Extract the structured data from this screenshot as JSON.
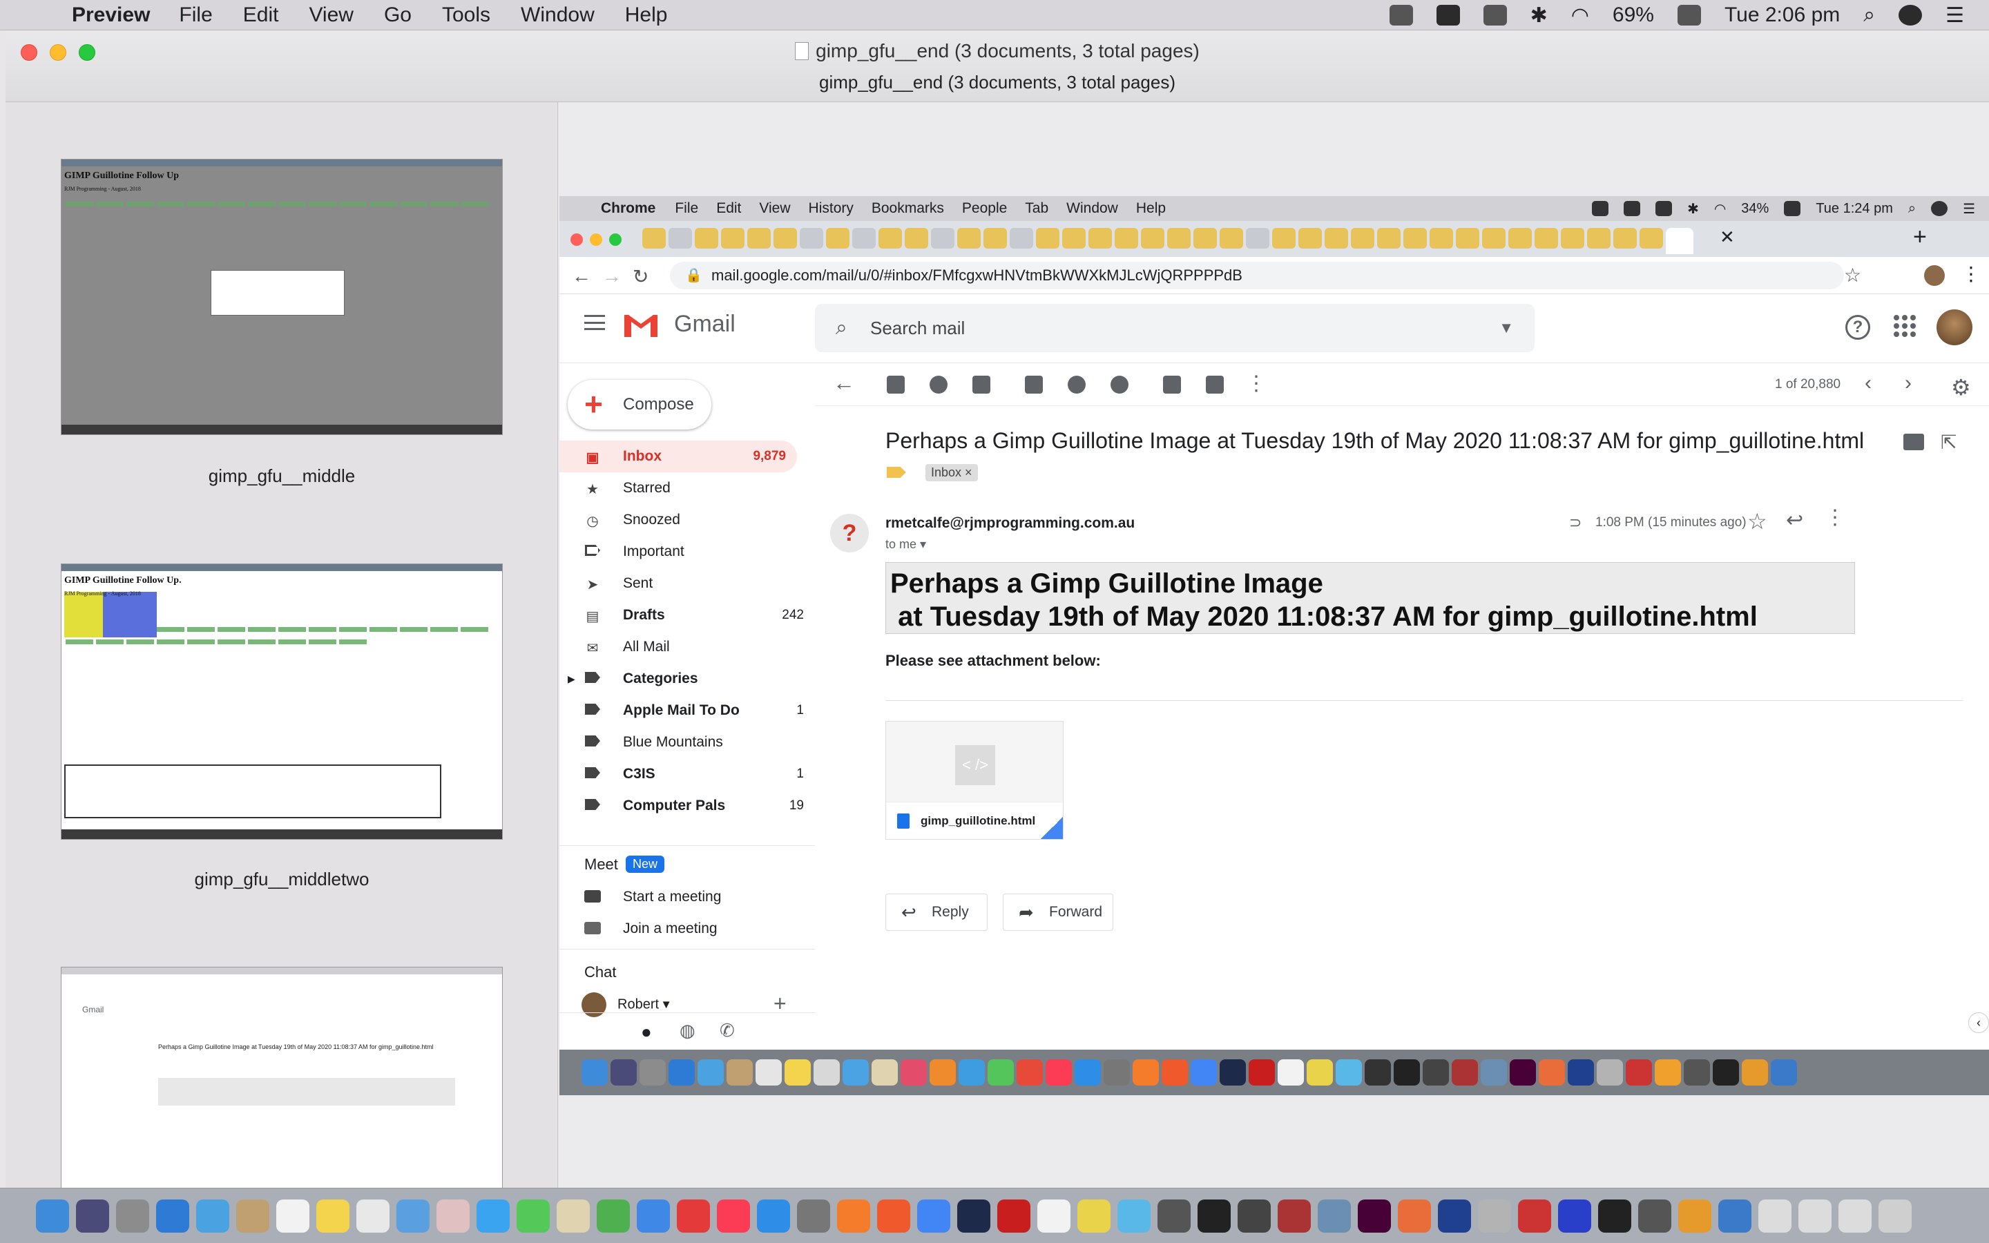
{
  "menubar": {
    "app": "Preview",
    "items": [
      "File",
      "Edit",
      "View",
      "Go",
      "Tools",
      "Window",
      "Help"
    ],
    "battery": "69%",
    "clock": "Tue 2:06 pm"
  },
  "window": {
    "title": "gimp_gfu__end (3 documents, 3 total pages)",
    "subtitle": "gimp_gfu__end (3 documents, 3 total pages)"
  },
  "thumbnails": [
    {
      "label": "gimp_gfu__middle",
      "title": "GIMP Guillotine Follow Up",
      "sub": "RJM Programming - August, 2018"
    },
    {
      "label": "gimp_gfu__middletwo",
      "title": "GIMP Guillotine Follow Up.",
      "sub": "RJM Programming - August, 2018"
    },
    {
      "label": "",
      "title": "Gmail",
      "sub": "Perhaps a Gimp Guillotine Image at Tuesday 19th of May 2020 11:08:37 AM for gimp_guillotine.html"
    }
  ],
  "inner_menubar": {
    "app": "Chrome",
    "items": [
      "File",
      "Edit",
      "View",
      "History",
      "Bookmarks",
      "People",
      "Tab",
      "Window",
      "Help"
    ],
    "battery": "34%",
    "clock": "Tue 1:24 pm"
  },
  "browser": {
    "url": "mail.google.com/mail/u/0/#inbox/FMfcgxwHNVtmBkWWXkMJLcWjQRPPPPdB"
  },
  "gmail": {
    "wordmark": "Gmail",
    "search_placeholder": "Search mail",
    "compose": "Compose",
    "nav": [
      {
        "label": "Inbox",
        "count": "9,879"
      },
      {
        "label": "Starred",
        "count": ""
      },
      {
        "label": "Snoozed",
        "count": ""
      },
      {
        "label": "Important",
        "count": ""
      },
      {
        "label": "Sent",
        "count": ""
      },
      {
        "label": "Drafts",
        "count": "242"
      },
      {
        "label": "All Mail",
        "count": ""
      },
      {
        "label": "Categories",
        "count": ""
      },
      {
        "label": "Apple Mail To Do",
        "count": "1"
      },
      {
        "label": "Blue Mountains",
        "count": ""
      },
      {
        "label": "C3IS",
        "count": "1"
      },
      {
        "label": "Computer Pals",
        "count": "19"
      }
    ],
    "meet": {
      "title": "Meet",
      "badge": "New",
      "start": "Start a meeting",
      "join": "Join a meeting"
    },
    "chat": {
      "title": "Chat",
      "user": "Robert"
    },
    "page_count": "1 of 20,880",
    "subject": "Perhaps a Gimp Guillotine Image at Tuesday 19th of May 2020 11:08:37 AM for gimp_guillotine.html",
    "label_chip": "Inbox ×",
    "sender": "rmetcalfe@rjmprogramming.com.au",
    "to": "to me",
    "time": "1:08 PM (15 minutes ago)",
    "body_heading": "Perhaps a Gimp Guillotine Image\n at Tuesday 19th of May 2020 11:08:37 AM for gimp_guillotine.html",
    "body_text": "Please see attachment below:",
    "attachment": {
      "name": "gimp_guillotine.html",
      "preview": "< />"
    },
    "reply": "Reply",
    "forward": "Forward"
  }
}
